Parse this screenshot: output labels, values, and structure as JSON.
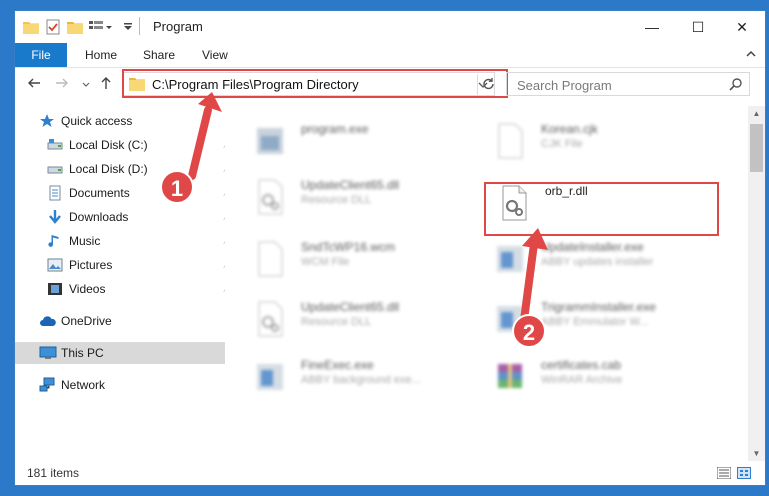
{
  "window": {
    "title": "Program"
  },
  "controls": {
    "minimize": "—",
    "maximize": "☐",
    "close": "✕"
  },
  "ribbon": {
    "tabs": [
      "File",
      "Home",
      "Share",
      "View"
    ]
  },
  "address": {
    "path": "C:\\Program Files\\Program Directory"
  },
  "search": {
    "placeholder": "Search Program"
  },
  "nav": {
    "items": [
      {
        "label": "Quick access",
        "icon": "star-icon"
      },
      {
        "label": "Local Disk (C:)",
        "icon": "drive-icon"
      },
      {
        "label": "Local Disk (D:)",
        "icon": "drive-icon"
      },
      {
        "label": "Documents",
        "icon": "documents-icon"
      },
      {
        "label": "Downloads",
        "icon": "download-icon"
      },
      {
        "label": "Music",
        "icon": "music-icon"
      },
      {
        "label": "Pictures",
        "icon": "pictures-icon"
      },
      {
        "label": "Videos",
        "icon": "videos-icon"
      },
      {
        "label": "OneDrive",
        "icon": "cloud-icon"
      },
      {
        "label": "This PC",
        "icon": "computer-icon"
      },
      {
        "label": "Network",
        "icon": "network-icon"
      }
    ]
  },
  "files": [
    {
      "name": "program.exe",
      "desc": ""
    },
    {
      "name": "Korean.cjk",
      "desc": "CJK File"
    },
    {
      "name": "UpdateClient65.dll",
      "desc": "Resource DLL"
    },
    {
      "name": "orb_r.dll",
      "desc": ""
    },
    {
      "name": "SndTcWP16.wcm",
      "desc": "WCM File"
    },
    {
      "name": "UpdateInstaller.exe",
      "desc": "ABBY updates installer"
    },
    {
      "name": "UpdateClient65.dll",
      "desc": "Resource DLL"
    },
    {
      "name": "TrigrammInstaller.exe",
      "desc": "ABBY Emmulator W..."
    },
    {
      "name": "FineExec.exe",
      "desc": "ABBY background exe..."
    },
    {
      "name": "certificates.cab",
      "desc": "WinRAR Archive"
    }
  ],
  "status": {
    "items_count": "181 items"
  },
  "callouts": [
    "1",
    "2"
  ],
  "colors": {
    "accent": "#1979ca",
    "highlight": "#e04848",
    "desktop": "#2b79c8"
  }
}
